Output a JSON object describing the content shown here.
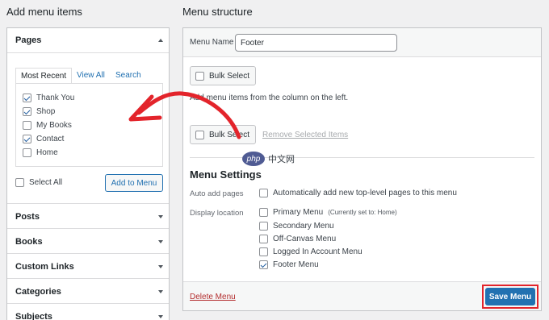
{
  "left": {
    "heading": "Add menu items",
    "pages_title": "Pages",
    "tabs": [
      "Most Recent",
      "View All",
      "Search"
    ],
    "items": [
      {
        "label": "Thank You",
        "checked": true
      },
      {
        "label": "Shop",
        "checked": true
      },
      {
        "label": "My Books",
        "checked": false
      },
      {
        "label": "Contact",
        "checked": true
      },
      {
        "label": "Home",
        "checked": false
      }
    ],
    "select_all": "Select All",
    "add_to_menu": "Add to Menu",
    "sections": [
      "Posts",
      "Books",
      "Custom Links",
      "Categories",
      "Subjects"
    ]
  },
  "right": {
    "heading": "Menu structure",
    "menu_name_label": "Menu Name",
    "menu_name_value": "Footer",
    "bulk_select_top": "Bulk Select",
    "hint": "Add menu items from the column on the left.",
    "bulk_select_bottom": "Bulk Select",
    "remove_selected": "Remove Selected Items",
    "settings_title": "Menu Settings",
    "auto_add_label": "Auto add pages",
    "auto_add_text": "Automatically add new top-level pages to this menu",
    "display_location_label": "Display location",
    "locations": [
      {
        "label": "Primary Menu",
        "note": "(Currently set to: Home)",
        "checked": false
      },
      {
        "label": "Secondary Menu",
        "note": "",
        "checked": false
      },
      {
        "label": "Off-Canvas Menu",
        "note": "",
        "checked": false
      },
      {
        "label": "Logged In Account Menu",
        "note": "",
        "checked": false
      },
      {
        "label": "Footer Menu",
        "note": "",
        "checked": true
      }
    ],
    "delete_menu": "Delete Menu",
    "save_menu": "Save Menu"
  },
  "watermark": {
    "text": "php 中文网"
  },
  "annotation": {
    "arrow_color": "#e3242b",
    "highlight_color": "#e3242b"
  }
}
